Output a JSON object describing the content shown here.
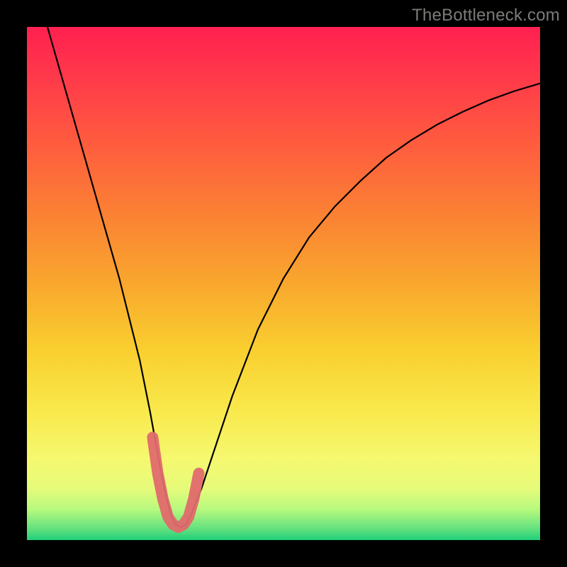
{
  "watermark": "TheBottleneck.com",
  "chart_data": {
    "type": "line",
    "title": "",
    "xlabel": "",
    "ylabel": "",
    "xlim": [
      0,
      100
    ],
    "ylim": [
      0,
      100
    ],
    "series": [
      {
        "name": "bottleneck-curve",
        "x": [
          4,
          6,
          8,
          10,
          12,
          14,
          16,
          18,
          20,
          22,
          24,
          26,
          27,
          28,
          29,
          30,
          31,
          32,
          34,
          36,
          40,
          45,
          50,
          55,
          60,
          65,
          70,
          75,
          80,
          85,
          90,
          95,
          100
        ],
        "y": [
          100,
          93,
          86,
          79,
          72,
          65,
          58,
          51,
          43,
          35,
          25,
          14,
          9,
          5,
          3,
          2.5,
          3,
          5,
          10,
          16,
          28,
          41,
          51,
          59,
          65,
          70,
          74.5,
          78,
          81,
          83.5,
          85.7,
          87.5,
          89
        ]
      },
      {
        "name": "highlight-segment",
        "x": [
          24.5,
          25.5,
          26.5,
          27.5,
          28.5,
          29.5,
          30.5,
          31.5,
          32.5,
          33.5
        ],
        "y": [
          20,
          13,
          8,
          4.5,
          3,
          2.5,
          3,
          4.5,
          8,
          13
        ]
      }
    ]
  }
}
